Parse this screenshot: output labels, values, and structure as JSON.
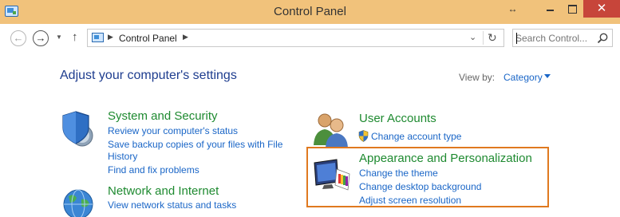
{
  "window": {
    "title": "Control Panel",
    "resize_glyph": "↔",
    "close_glyph": "✕"
  },
  "nav": {
    "back_glyph": "←",
    "forward_glyph": "→",
    "recent_glyph": "▼",
    "up_glyph": "↑"
  },
  "address": {
    "crumb": "Control Panel",
    "separator": "▶",
    "dropdown_glyph": "⌄",
    "refresh_glyph": "↻"
  },
  "search": {
    "placeholder": "Search Control..."
  },
  "header": {
    "title": "Adjust your computer's settings",
    "view_by_label": "View by:",
    "view_by_value": "Category"
  },
  "categories": {
    "system": {
      "title": "System and Security",
      "links": [
        "Review your computer's status",
        "Save backup copies of your files with File",
        "History",
        "Find and fix problems"
      ]
    },
    "network": {
      "title": "Network and Internet",
      "links": [
        "View network status and tasks"
      ]
    },
    "user": {
      "title": "User Accounts",
      "links": [
        "Change account type"
      ]
    },
    "appearance": {
      "title": "Appearance and Personalization",
      "links": [
        "Change the theme",
        "Change desktop background",
        "Adjust screen resolution"
      ]
    }
  },
  "colors": {
    "titlebar": "#f1c27b",
    "close_button": "#c7453a",
    "category_title": "#1e8a30",
    "link": "#1a66c7",
    "heading": "#1e3d8f",
    "highlight": "#e0791f"
  },
  "icons": {
    "app": "control-panel-icon",
    "system": "shield-icon",
    "network": "globe-icon",
    "user": "users-icon",
    "appearance": "monitor-palette-icon",
    "uac": "uac-shield-icon",
    "search": "search-icon"
  }
}
